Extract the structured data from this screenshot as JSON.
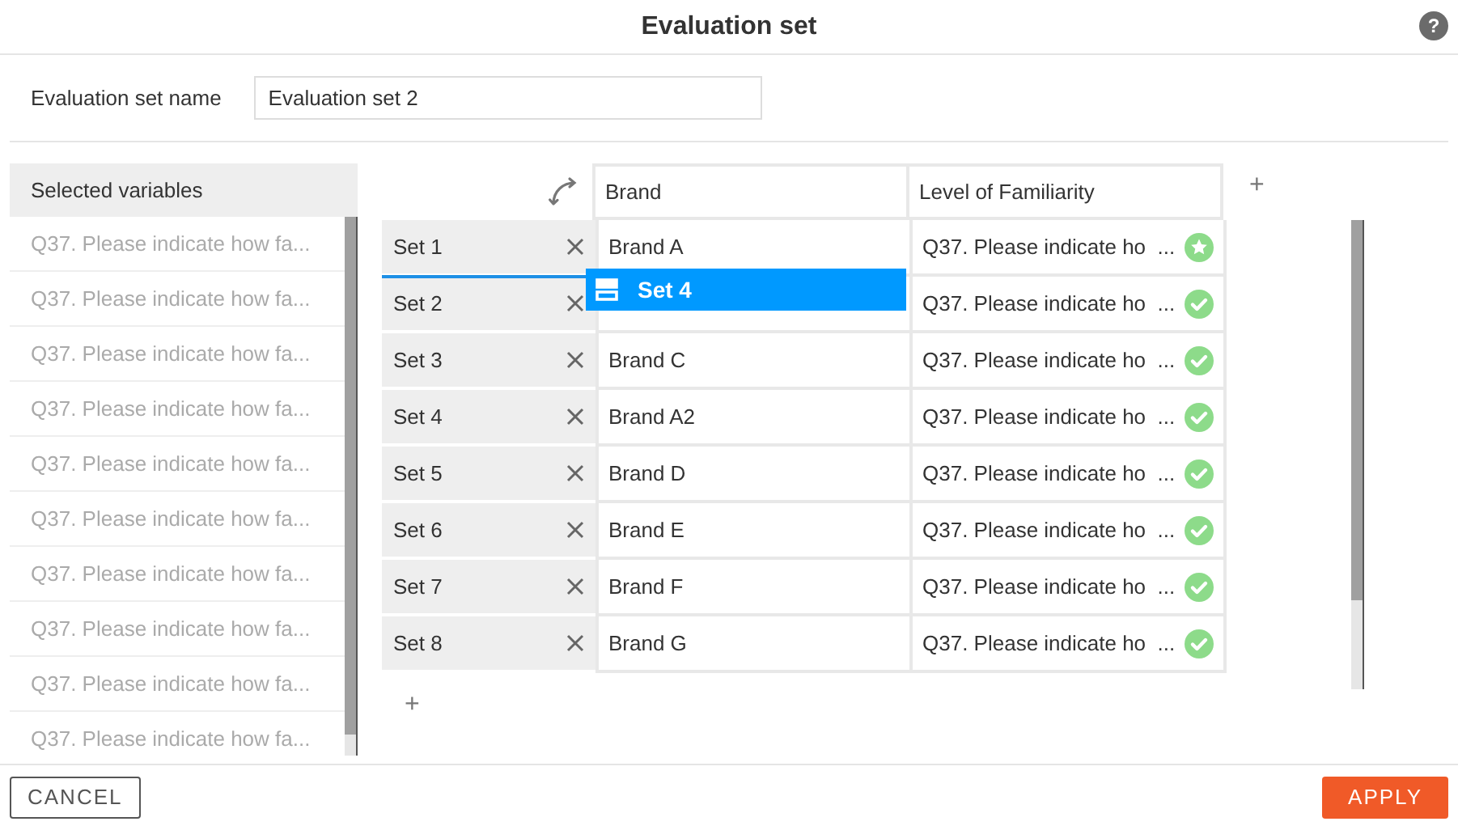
{
  "window": {
    "title": "Evaluation set",
    "help": "?"
  },
  "name_field": {
    "label": "Evaluation set name",
    "value": "Evaluation set 2"
  },
  "selected_variables": {
    "title": "Selected variables",
    "items": [
      "Q37. Please indicate how fa...",
      "Q37. Please indicate how fa...",
      "Q37. Please indicate how fa...",
      "Q37. Please indicate how fa...",
      "Q37. Please indicate how fa...",
      "Q37. Please indicate how fa...",
      "Q37. Please indicate how fa...",
      "Q37. Please indicate how fa...",
      "Q37. Please indicate how fa...",
      "Q37. Please indicate how fa..."
    ]
  },
  "table": {
    "columns": [
      "Brand",
      "Level of Familiarity"
    ],
    "rows": [
      {
        "set": "Set 1",
        "brand": "Brand A",
        "variable": "Q37. Please indicate ho  ...",
        "kind": "star"
      },
      {
        "set": "Set 2",
        "variable": "Q37. Please indicate ho  ...",
        "kind": "check"
      },
      {
        "set": "Set 3",
        "brand": "Brand C",
        "variable": "Q37. Please indicate ho  ...",
        "kind": "check"
      },
      {
        "set": "Set 4",
        "brand": "Brand A2",
        "variable": "Q37. Please indicate ho  ...",
        "kind": "check"
      },
      {
        "set": "Set 5",
        "brand": "Brand D",
        "variable": "Q37. Please indicate ho  ...",
        "kind": "check"
      },
      {
        "set": "Set 6",
        "brand": "Brand E",
        "variable": "Q37. Please indicate ho  ...",
        "kind": "check"
      },
      {
        "set": "Set 7",
        "brand": "Brand F",
        "variable": "Q37. Please indicate ho  ...",
        "kind": "check"
      },
      {
        "set": "Set 8",
        "brand": "Brand G",
        "variable": "Q37. Please indicate ho  ...",
        "kind": "check"
      }
    ],
    "add_column": "+",
    "add_row": "+"
  },
  "drag_item": {
    "label": "Set 4"
  },
  "buttons": {
    "cancel": "CANCEL",
    "apply": "APPLY"
  }
}
